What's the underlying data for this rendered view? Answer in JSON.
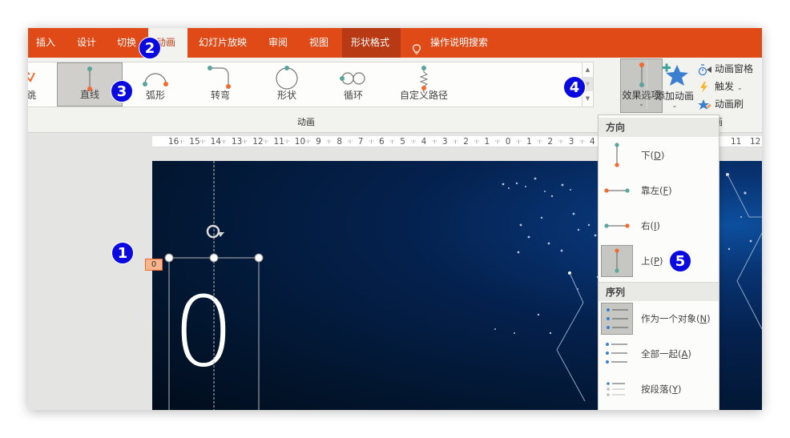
{
  "ribbon_tabs": [
    {
      "label": "插入"
    },
    {
      "label": "设计"
    },
    {
      "label": "切换"
    },
    {
      "label": "动画",
      "active": true
    },
    {
      "label": "幻灯片放映"
    },
    {
      "label": "审阅"
    },
    {
      "label": "视图"
    },
    {
      "label": "形状格式",
      "contextual": true
    },
    {
      "label": "操作说明搜索",
      "icon": "lightbulb-icon"
    }
  ],
  "animation_gallery": {
    "partial_item_label": "跳",
    "items": [
      {
        "label": "直线",
        "icon": "path-line-icon",
        "selected": true
      },
      {
        "label": "弧形",
        "icon": "path-arc-icon"
      },
      {
        "label": "转弯",
        "icon": "path-turn-icon"
      },
      {
        "label": "形状",
        "icon": "path-shape-icon"
      },
      {
        "label": "循环",
        "icon": "path-loop-icon"
      },
      {
        "label": "自定义路径",
        "icon": "path-custom-icon"
      }
    ],
    "scroll": {
      "up": "▲",
      "down": "▼",
      "more": "▼"
    },
    "group_label": "动画"
  },
  "effect_options": {
    "label": "效果选项",
    "chevron": "⌄"
  },
  "add_animation": {
    "label": "添加动画",
    "chevron": "⌄",
    "group_label_fragment": "画"
  },
  "side_commands": [
    {
      "label": "动画窗格",
      "icon": "animation-pane-icon"
    },
    {
      "label": "触发",
      "icon": "trigger-icon",
      "has_dropdown": true
    },
    {
      "label": "动画刷",
      "icon": "animation-painter-icon"
    }
  ],
  "ruler": {
    "labels": [
      "16",
      "15",
      "14",
      "13",
      "12",
      "11",
      "10",
      "9",
      "8",
      "7",
      "6",
      "5",
      "4",
      "3",
      "2",
      "1",
      "0",
      "1",
      "2",
      "3",
      "4"
    ],
    "right_labels": [
      "11",
      "12"
    ]
  },
  "slide": {
    "big_text": "0",
    "position_tag": "0"
  },
  "dropdown": {
    "sections": [
      {
        "header": "方向",
        "items": [
          {
            "label": "下",
            "key": "D",
            "icon": "direction-down-icon"
          },
          {
            "label": "靠左",
            "key": "F",
            "icon": "direction-left-icon"
          },
          {
            "label": "右",
            "key": "I",
            "icon": "direction-right-icon"
          },
          {
            "label": "上",
            "key": "P",
            "icon": "direction-up-icon",
            "selected": true
          }
        ]
      },
      {
        "header": "序列",
        "items": [
          {
            "label": "作为一个对象",
            "key": "N",
            "icon": "as-one-object-icon",
            "selected": true
          },
          {
            "label": "全部一起",
            "key": "A",
            "icon": "all-at-once-icon"
          },
          {
            "label": "按段落",
            "key": "Y",
            "icon": "by-paragraph-icon"
          }
        ]
      }
    ]
  },
  "callouts": [
    "1",
    "2",
    "3",
    "4",
    "5"
  ],
  "colors": {
    "ribbon_orange": "#e04a17",
    "contextual_tab": "#b83a14",
    "path_start_teal": "#5aa59b",
    "path_end_orange": "#f26a2e",
    "callout_blue": "#0a0ae0",
    "star_blue": "#3a7fd0"
  }
}
